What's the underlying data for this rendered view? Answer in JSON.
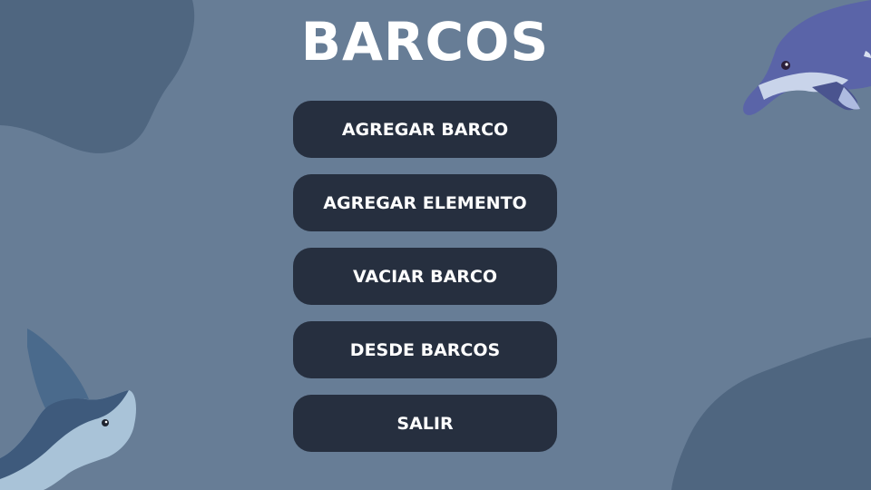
{
  "title": "BARCOS",
  "menu": {
    "add_boat": "AGREGAR BARCO",
    "add_element": "AGREGAR ELEMENTO",
    "empty_boat": "VACIAR BARCO",
    "unload_boats": "DESDE BARCOS",
    "exit": "SALIR"
  },
  "colors": {
    "background": "#677d96",
    "blob": "#4f6680",
    "button": "#262f3f",
    "text": "#ffffff"
  },
  "icons": [
    "dolphin-illustration",
    "manta-ray-illustration"
  ]
}
